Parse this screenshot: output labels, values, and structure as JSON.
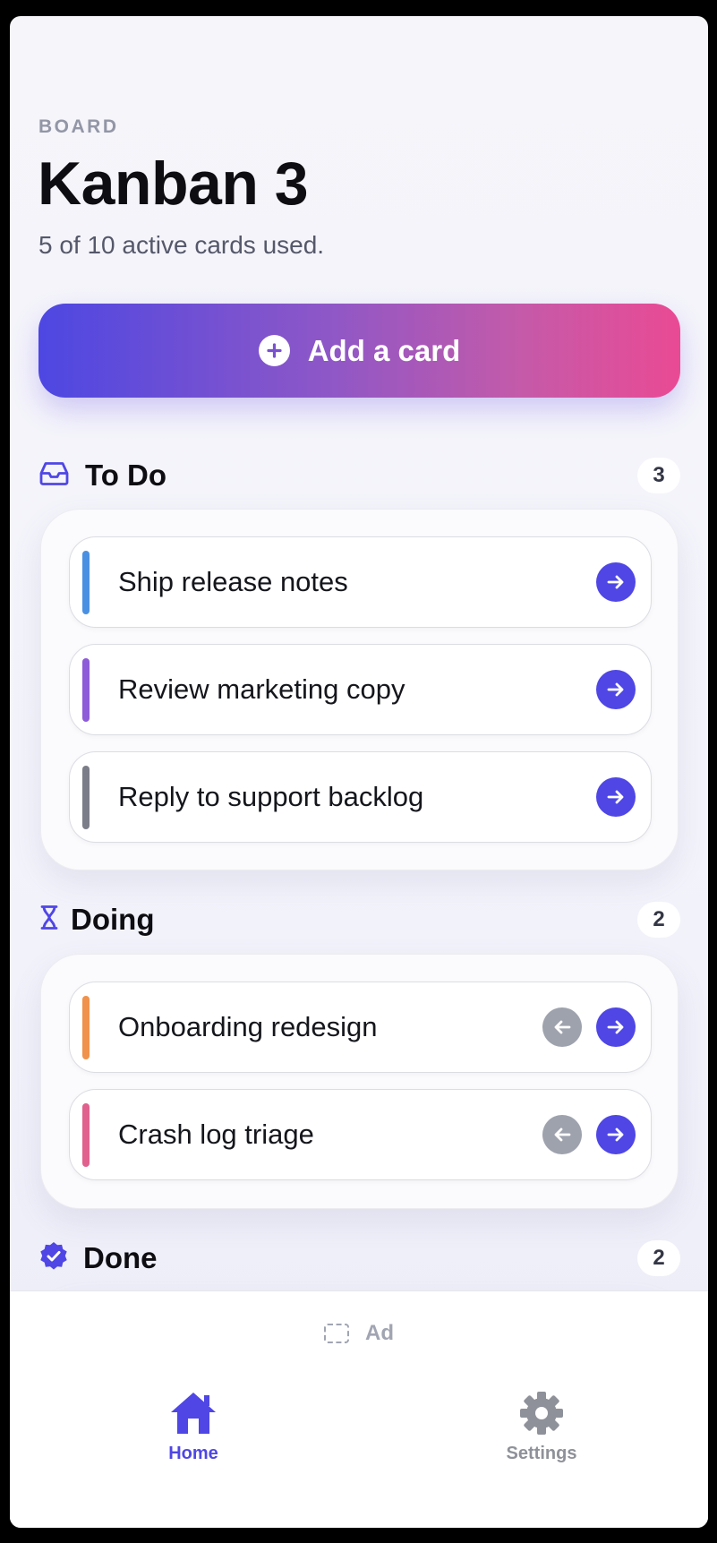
{
  "header": {
    "eyebrow": "BOARD",
    "title": "Kanban 3",
    "subtitle": "5 of 10 active cards used."
  },
  "add_button": {
    "label": "Add a card",
    "icon": "plus-circle-icon"
  },
  "sections": {
    "todo": {
      "title": "To Do",
      "count": "3",
      "icon": "tray-icon",
      "cards": [
        {
          "text": "Ship release notes",
          "color": "#4a90e2"
        },
        {
          "text": "Review marketing copy",
          "color": "#8e5bd9"
        },
        {
          "text": "Reply to support backlog",
          "color": "#7b7d88"
        }
      ]
    },
    "doing": {
      "title": "Doing",
      "count": "2",
      "icon": "hourglass-icon",
      "cards": [
        {
          "text": "Onboarding redesign",
          "color": "#f0924b"
        },
        {
          "text": "Crash log triage",
          "color": "#e0618d"
        }
      ]
    },
    "done": {
      "title": "Done",
      "count": "2",
      "icon": "check-badge-icon"
    }
  },
  "ad": {
    "label": "Ad"
  },
  "tabbar": {
    "home": {
      "label": "Home",
      "icon": "home-icon"
    },
    "settings": {
      "label": "Settings",
      "icon": "gear-icon"
    }
  },
  "colors": {
    "accent": "#4f46e5",
    "gradient_start": "#4d47e2",
    "gradient_end": "#ea4a94",
    "inactive": "#8e9199"
  }
}
